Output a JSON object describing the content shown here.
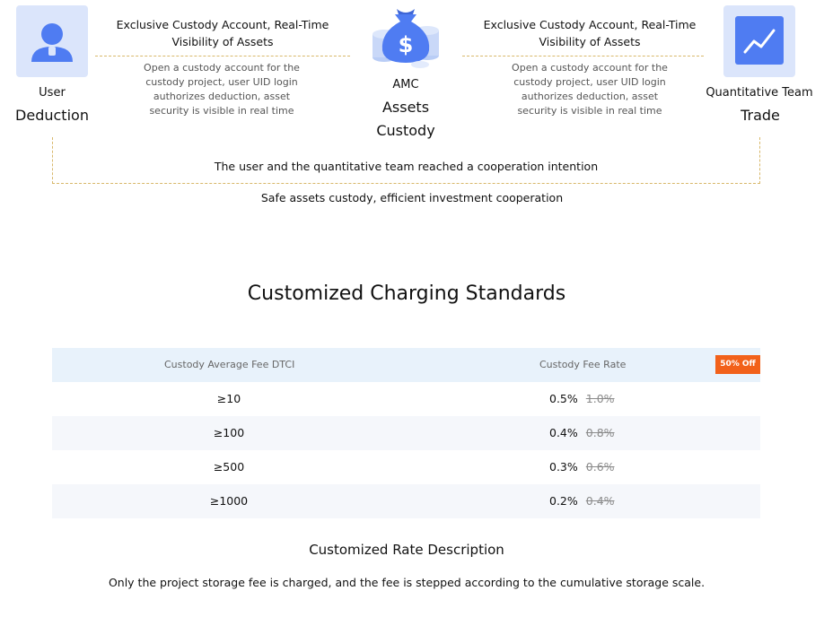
{
  "flow": {
    "user": {
      "line1": "User",
      "line2": "Deduction",
      "icon": "user-icon"
    },
    "left_panel": {
      "title": "Exclusive Custody Account, Real-Time Visibility of Assets",
      "description": "Open a custody account for the custody project, user UID login authorizes deduction, asset security is visible in real time"
    },
    "center": {
      "line1": "AMC",
      "line2": "Assets",
      "line3": "Custody",
      "icon": "money-bag-icon"
    },
    "right_panel": {
      "title": "Exclusive Custody Account, Real-Time Visibility of Assets",
      "description": "Open a custody account for the custody project, user UID login authorizes deduction, asset security is visible in real time"
    },
    "team": {
      "line1": "Quantitative Team",
      "line2": "Trade",
      "icon": "chart-trend-icon"
    },
    "cooperation_text": "The user and the quantitative team reached a cooperation intention",
    "safe_text": "Safe assets custody, efficient investment cooperation"
  },
  "pricing": {
    "title": "Customized Charging Standards",
    "columns": [
      "Custody Average Fee DTCI",
      "Custody Fee Rate"
    ],
    "badge": "50% Off",
    "rows": [
      {
        "tier": "≥10",
        "rate": "0.5%",
        "old_rate": "1.0%"
      },
      {
        "tier": "≥100",
        "rate": "0.4%",
        "old_rate": "0.8%"
      },
      {
        "tier": "≥500",
        "rate": "0.3%",
        "old_rate": "0.6%"
      },
      {
        "tier": "≥1000",
        "rate": "0.2%",
        "old_rate": "0.4%"
      }
    ],
    "description_title": "Customized Rate Description",
    "description_text": "Only the project storage fee is charged, and the fee is stepped according to the cumulative storage scale."
  },
  "colors": {
    "icon_blue": "#4f7cf2",
    "tile_bg": "#dbe5fb",
    "badge_orange": "#f2611a",
    "header_bg": "#e8f2fb",
    "dashed_gold": "#d8b86a"
  }
}
